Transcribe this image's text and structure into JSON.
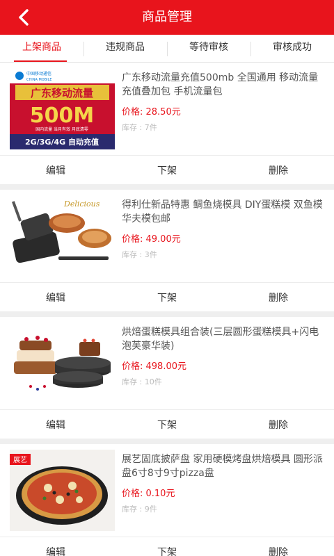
{
  "header": {
    "title": "商品管理"
  },
  "tabs": [
    "上架商品",
    "违规商品",
    "等待审核",
    "审核成功"
  ],
  "colors": {
    "accent": "#e8141c"
  },
  "products": [
    {
      "name": "广东移动流量充值500mb 全国通用 移动流量充值叠加包 手机流量包",
      "price": "价格: 28.50元",
      "stock": "库存 : 7件",
      "image": {
        "logo": "中国移动通信",
        "logo_en": "CHINA MOBILE",
        "title": "广东移动流量",
        "amount": "500M",
        "note": "国内流量 当月有效 月底清零",
        "footer": "2G/3G/4G 自动充值"
      }
    },
    {
      "name": "得利仕新品特惠 鲷鱼烧模具 DIY蛋糕模 双鱼模华夫模包邮",
      "price": "价格: 49.00元",
      "stock": "库存 : 3件",
      "image": {
        "brand": "Delicious"
      }
    },
    {
      "name": "烘焙蛋糕模具组合装(三层圆形蛋糕模具+闪电泡芙豪华装)",
      "price": "价格: 498.00元",
      "stock": "库存 : 10件",
      "image": {}
    },
    {
      "name": "展艺固底披萨盘 家用硬模烤盘烘焙模具 圆形派盘6寸8寸9寸pizza盘",
      "price": "价格: 0.10元",
      "stock": "库存 : 9件",
      "image": {
        "badge": "展艺"
      }
    }
  ],
  "actions": {
    "edit": "编辑",
    "offline": "下架",
    "delete": "删除"
  }
}
